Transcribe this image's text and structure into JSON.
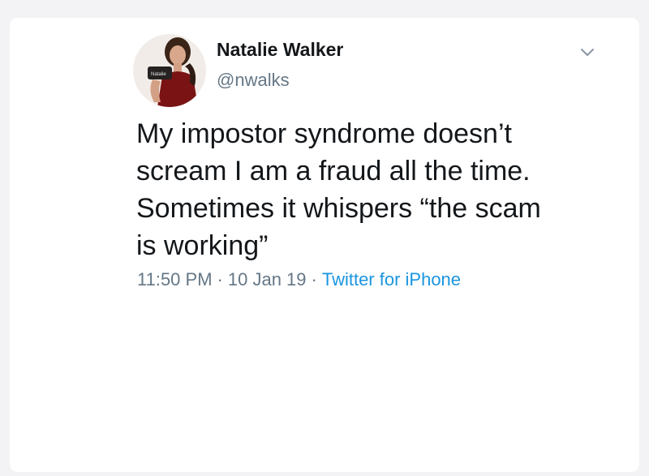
{
  "tweet": {
    "author_name": "Natalie Walker",
    "author_handle": "@nwalks",
    "text": "My impostor syndrome doesn’t\nscream I am a fraud all the time.\nSometimes it whispers “the scam\nis working”",
    "time": "11:50 PM",
    "date": "10 Jan 19",
    "separator": "·",
    "source": "Twitter for iPhone"
  },
  "icons": {
    "avatar": "profile-photo",
    "menu": "chevron-down-icon"
  },
  "colors": {
    "text_primary": "#14171a",
    "text_secondary": "#657786",
    "link": "#1b95e0"
  }
}
